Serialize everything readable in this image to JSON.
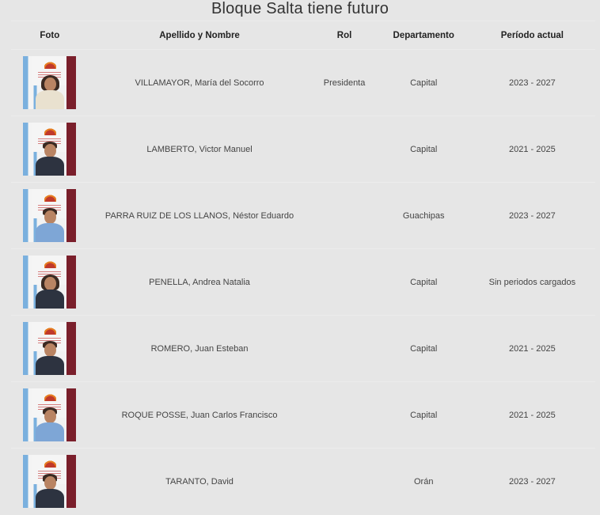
{
  "title": "Bloque Salta tiene futuro",
  "headers": {
    "foto": "Foto",
    "nombre": "Apellido y Nombre",
    "rol": "Rol",
    "departamento": "Departamento",
    "periodo": "Período actual"
  },
  "rows": [
    {
      "nombre": "VILLAMAYOR, María del Socorro",
      "rol": "Presidenta",
      "departamento": "Capital",
      "periodo": "2023 - 2027",
      "photo_icon": "member-photo"
    },
    {
      "nombre": "LAMBERTO, Victor Manuel",
      "rol": "",
      "departamento": "Capital",
      "periodo": "2021 - 2025",
      "photo_icon": "member-photo"
    },
    {
      "nombre": "PARRA RUIZ DE LOS LLANOS, Néstor Eduardo",
      "rol": "",
      "departamento": "Guachipas",
      "periodo": "2023 - 2027",
      "photo_icon": "member-photo"
    },
    {
      "nombre": "PENELLA, Andrea Natalia",
      "rol": "",
      "departamento": "Capital",
      "periodo": "Sin periodos cargados",
      "photo_icon": "member-photo"
    },
    {
      "nombre": "ROMERO, Juan Esteban",
      "rol": "",
      "departamento": "Capital",
      "periodo": "2021 - 2025",
      "photo_icon": "member-photo"
    },
    {
      "nombre": "ROQUE POSSE, Juan Carlos Francisco",
      "rol": "",
      "departamento": "Capital",
      "periodo": "2021 - 2025",
      "photo_icon": "member-photo"
    },
    {
      "nombre": "TARANTO, David",
      "rol": "",
      "departamento": "Orán",
      "periodo": "2023 - 2027",
      "photo_icon": "member-photo"
    }
  ]
}
